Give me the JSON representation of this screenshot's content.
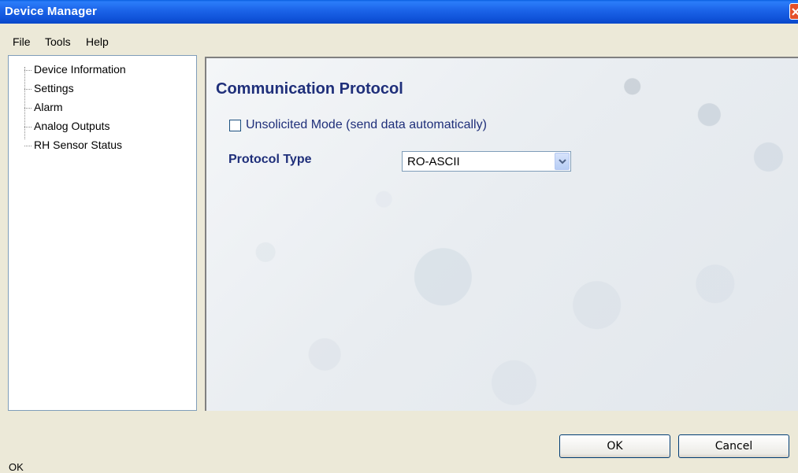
{
  "window": {
    "title": "Device Manager"
  },
  "menu": [
    "File",
    "Tools",
    "Help"
  ],
  "tree": {
    "items": [
      "Device Information",
      "Settings",
      "Alarm",
      "Analog Outputs",
      "RH Sensor Status"
    ]
  },
  "content": {
    "heading": "Communication Protocol",
    "unsolicited_label": "Unsolicited Mode (send data automatically)",
    "unsolicited_checked": false,
    "protocol_label": "Protocol Type",
    "protocol_value": "RO-ASCII"
  },
  "buttons": {
    "ok": "OK",
    "cancel": "Cancel"
  },
  "status": "OK",
  "colors": {
    "title_blue": "#0f52d8",
    "heading_text": "#1f2f7a",
    "close_red": "#e3502a"
  }
}
